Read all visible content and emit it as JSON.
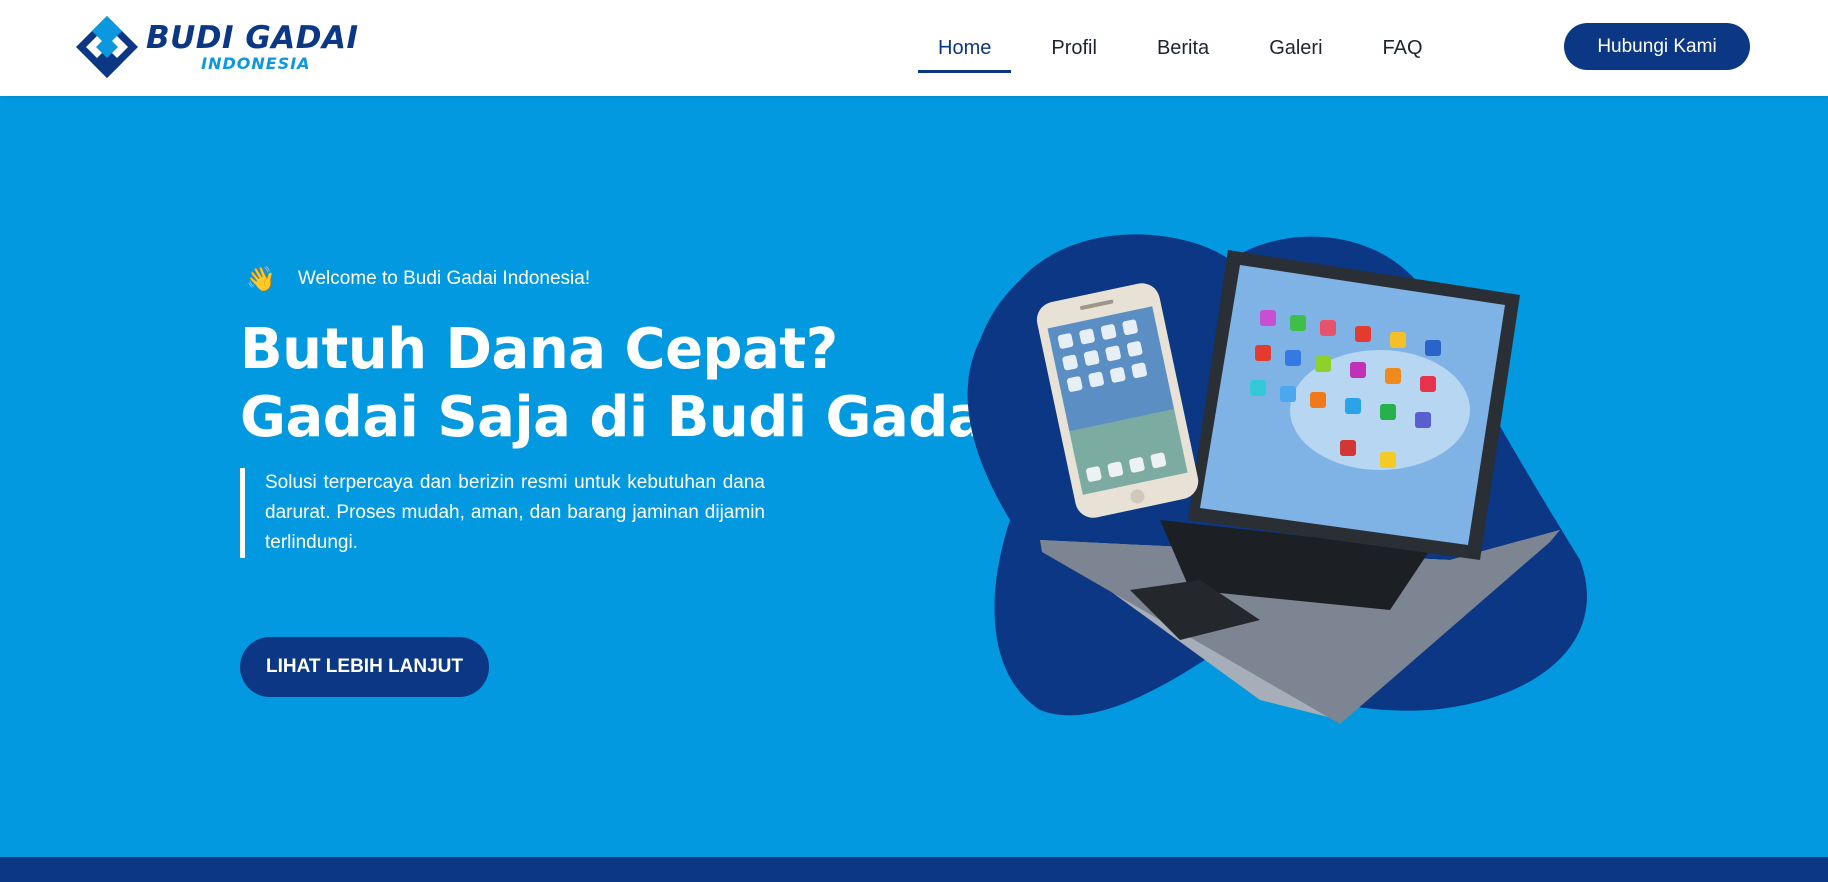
{
  "brand": {
    "name": "BUDI GADAI",
    "sub": "INDONESIA",
    "colors": {
      "primary": "#0b3784",
      "accent": "#0399e0",
      "white": "#ffffff"
    }
  },
  "nav": {
    "items": [
      {
        "label": "Home",
        "active": true
      },
      {
        "label": "Profil",
        "active": false
      },
      {
        "label": "Berita",
        "active": false
      },
      {
        "label": "Galeri",
        "active": false
      },
      {
        "label": "FAQ",
        "active": false
      }
    ],
    "cta_label": "Hubungi Kami"
  },
  "hero": {
    "wave_icon": "👋",
    "welcome": "Welcome to Budi Gadai Indonesia!",
    "headline_line1": "Butuh Dana Cepat?",
    "headline_line2": "Gadai Saja di Budi Gadai!",
    "description": "Solusi terpercaya dan berizin resmi untuk kebutuhan dana darurat. Proses mudah, aman, dan barang jaminan dijamin terlindungi.",
    "button_label": "LIHAT LEBIH LANJUT",
    "image_icon": "laptop-phone-illustration"
  }
}
